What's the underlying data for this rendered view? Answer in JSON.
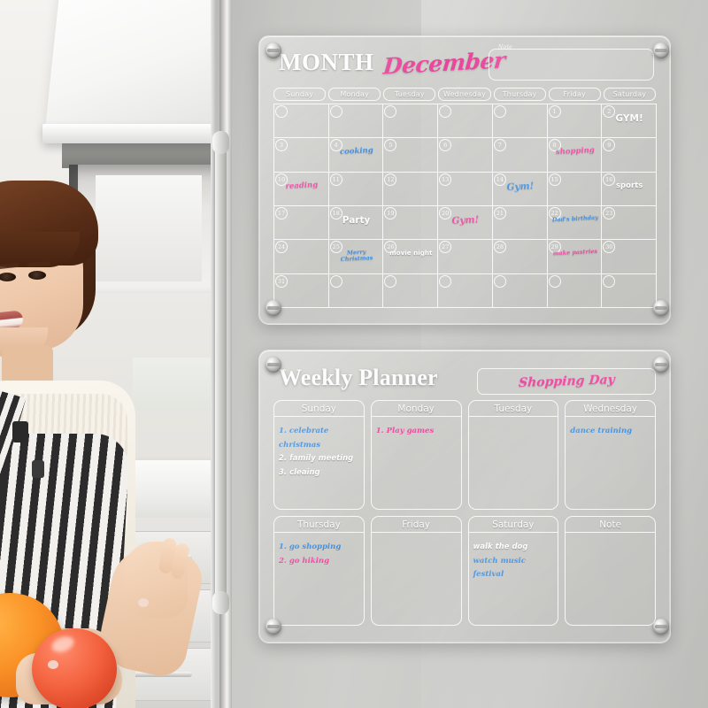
{
  "scene": {
    "description": "woman-holding-fruit-in-kitchen-beside-fridge-with-acrylic-planner-boards"
  },
  "month_board": {
    "title_word": "MONTH",
    "month_name": "December",
    "note_label": "Note",
    "note_value": "",
    "weekdays": [
      "Sunday",
      "Monday",
      "Tuesday",
      "Wednesday",
      "Thursday",
      "Friday",
      "Saturday"
    ],
    "cells": [
      {
        "num": "",
        "text": "",
        "color": ""
      },
      {
        "num": "",
        "text": "",
        "color": ""
      },
      {
        "num": "",
        "text": "",
        "color": ""
      },
      {
        "num": "",
        "text": "",
        "color": ""
      },
      {
        "num": "",
        "text": "",
        "color": ""
      },
      {
        "num": "1",
        "text": "",
        "color": ""
      },
      {
        "num": "2",
        "text": "GYM!",
        "color": "white"
      },
      {
        "num": "3",
        "text": "",
        "color": ""
      },
      {
        "num": "4",
        "text": "cooking",
        "color": "blue"
      },
      {
        "num": "5",
        "text": "",
        "color": ""
      },
      {
        "num": "6",
        "text": "",
        "color": ""
      },
      {
        "num": "7",
        "text": "",
        "color": ""
      },
      {
        "num": "8",
        "text": "shopping",
        "color": "pink"
      },
      {
        "num": "9",
        "text": "",
        "color": ""
      },
      {
        "num": "10",
        "text": "reading",
        "color": "pink"
      },
      {
        "num": "11",
        "text": "",
        "color": ""
      },
      {
        "num": "12",
        "text": "",
        "color": ""
      },
      {
        "num": "13",
        "text": "",
        "color": ""
      },
      {
        "num": "14",
        "text": "Gym!",
        "color": "blue"
      },
      {
        "num": "15",
        "text": "",
        "color": ""
      },
      {
        "num": "16",
        "text": "sports",
        "color": "white"
      },
      {
        "num": "17",
        "text": "",
        "color": ""
      },
      {
        "num": "18",
        "text": "Party",
        "color": "white"
      },
      {
        "num": "19",
        "text": "",
        "color": ""
      },
      {
        "num": "20",
        "text": "Gym!",
        "color": "pink"
      },
      {
        "num": "21",
        "text": "",
        "color": ""
      },
      {
        "num": "22",
        "text": "Dad's birthday",
        "color": "blue"
      },
      {
        "num": "23",
        "text": "",
        "color": ""
      },
      {
        "num": "24",
        "text": "",
        "color": ""
      },
      {
        "num": "25",
        "text": "Merry Christmas",
        "color": "blue"
      },
      {
        "num": "26",
        "text": "movie night",
        "color": "white"
      },
      {
        "num": "27",
        "text": "",
        "color": ""
      },
      {
        "num": "28",
        "text": "",
        "color": ""
      },
      {
        "num": "29",
        "text": "make pastries",
        "color": "pink"
      },
      {
        "num": "30",
        "text": "",
        "color": ""
      },
      {
        "num": "31",
        "text": "",
        "color": ""
      },
      {
        "num": "",
        "text": "",
        "color": ""
      },
      {
        "num": "",
        "text": "",
        "color": ""
      },
      {
        "num": "",
        "text": "",
        "color": ""
      },
      {
        "num": "",
        "text": "",
        "color": ""
      },
      {
        "num": "",
        "text": "",
        "color": ""
      },
      {
        "num": "",
        "text": "",
        "color": ""
      }
    ]
  },
  "week_board": {
    "title": "Weekly Planner",
    "note_value": "Shopping Day",
    "days": [
      {
        "name": "Sunday",
        "lines": [
          {
            "text": "1. celebrate",
            "color": "blue"
          },
          {
            "text": "christmas",
            "color": "blue"
          },
          {
            "text": "2. family meeting",
            "color": "white"
          },
          {
            "text": "3. cleaing",
            "color": "white"
          }
        ]
      },
      {
        "name": "Monday",
        "lines": [
          {
            "text": "1. Play games",
            "color": "pink"
          }
        ]
      },
      {
        "name": "Tuesday",
        "lines": []
      },
      {
        "name": "Wednesday",
        "lines": [
          {
            "text": "dance training",
            "color": "blue"
          }
        ]
      },
      {
        "name": "Thursday",
        "lines": [
          {
            "text": "1. go shopping",
            "color": "blue"
          },
          {
            "text": "2. go hiking",
            "color": "pink"
          }
        ]
      },
      {
        "name": "Friday",
        "lines": []
      },
      {
        "name": "Saturday",
        "lines": [
          {
            "text": "walk the dog",
            "color": "white"
          },
          {
            "text": "watch music",
            "color": "blue"
          },
          {
            "text": "festival",
            "color": "blue"
          }
        ]
      },
      {
        "name": "Note",
        "lines": []
      }
    ]
  },
  "colors": {
    "marker_pink": "#ef4aa2",
    "marker_blue": "#3f8fe0",
    "marker_white": "#fdfdfd",
    "acrylic": "#c9c9c6",
    "fridge": "#c6c6c3"
  }
}
